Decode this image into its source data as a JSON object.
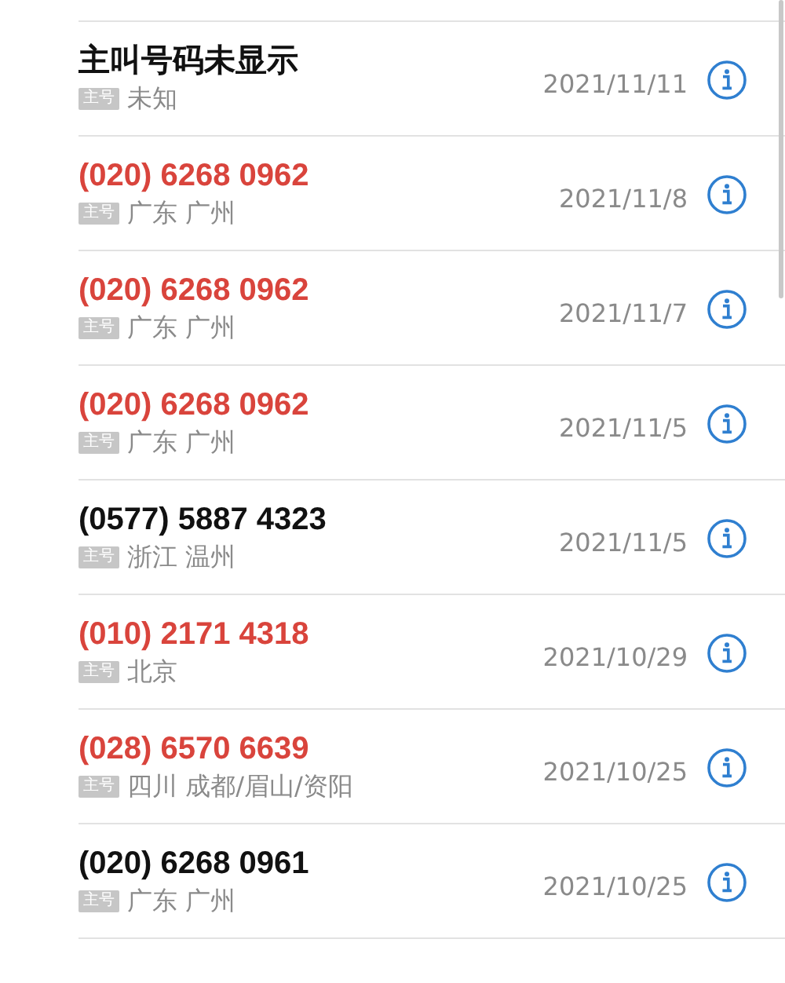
{
  "calls": [
    {
      "number": "主叫号码未显示",
      "missed": false,
      "tag": "主号",
      "location": "未知",
      "date": "2021/11/11"
    },
    {
      "number": "(020) 6268 0962",
      "missed": true,
      "tag": "主号",
      "location": "广东 广州",
      "date": "2021/11/8"
    },
    {
      "number": "(020) 6268 0962",
      "missed": true,
      "tag": "主号",
      "location": "广东 广州",
      "date": "2021/11/7"
    },
    {
      "number": "(020) 6268 0962",
      "missed": true,
      "tag": "主号",
      "location": "广东 广州",
      "date": "2021/11/5"
    },
    {
      "number": "(0577) 5887 4323",
      "missed": false,
      "tag": "主号",
      "location": "浙江 温州",
      "date": "2021/11/5"
    },
    {
      "number": "(010) 2171 4318",
      "missed": true,
      "tag": "主号",
      "location": "北京",
      "date": "2021/10/29"
    },
    {
      "number": "(028) 6570 6639",
      "missed": true,
      "tag": "主号",
      "location": "四川 成都/眉山/资阳",
      "date": "2021/10/25"
    },
    {
      "number": "(020) 6268 0961",
      "missed": false,
      "tag": "主号",
      "location": "广东 广州",
      "date": "2021/10/25"
    }
  ]
}
